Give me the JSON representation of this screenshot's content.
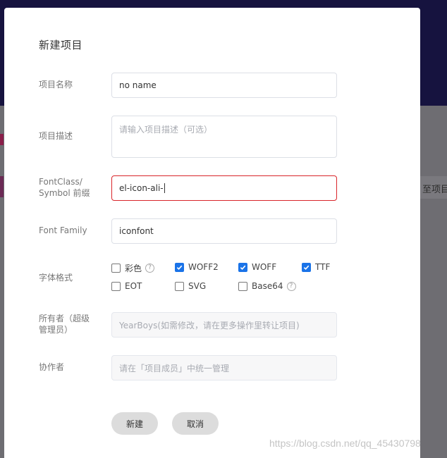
{
  "background": {
    "peek_text": "至项目"
  },
  "modal": {
    "title": "新建项目",
    "fields": {
      "name": {
        "label": "项目名称",
        "value": "no name"
      },
      "description": {
        "label": "项目描述",
        "placeholder": "请输入项目描述（可选）"
      },
      "prefix": {
        "label": "FontClass/ Symbol 前缀",
        "value": "el-icon-ali-"
      },
      "family": {
        "label": "Font Family",
        "value": "iconfont"
      },
      "formats": {
        "label": "字体格式",
        "options": [
          {
            "label": "彩色",
            "checked": false,
            "help": true
          },
          {
            "label": "WOFF2",
            "checked": true
          },
          {
            "label": "WOFF",
            "checked": true
          },
          {
            "label": "TTF",
            "checked": true
          },
          {
            "label": "EOT",
            "checked": false
          },
          {
            "label": "SVG",
            "checked": false
          },
          {
            "label": "Base64",
            "checked": false,
            "help": true
          }
        ]
      },
      "owner": {
        "label": "所有者（超级管理员）",
        "placeholder": "YearBoys(如需修改，请在更多操作里转让项目)"
      },
      "collaborators": {
        "label": "协作者",
        "placeholder": "请在「项目成员」中统一管理"
      }
    },
    "buttons": {
      "create": "新建",
      "cancel": "取消"
    }
  },
  "watermark": "https://blog.csdn.net/qq_45430798",
  "colors": {
    "accent": "#1a73e8",
    "error_border": "#d9252a",
    "backdrop_top": "#16133f"
  }
}
